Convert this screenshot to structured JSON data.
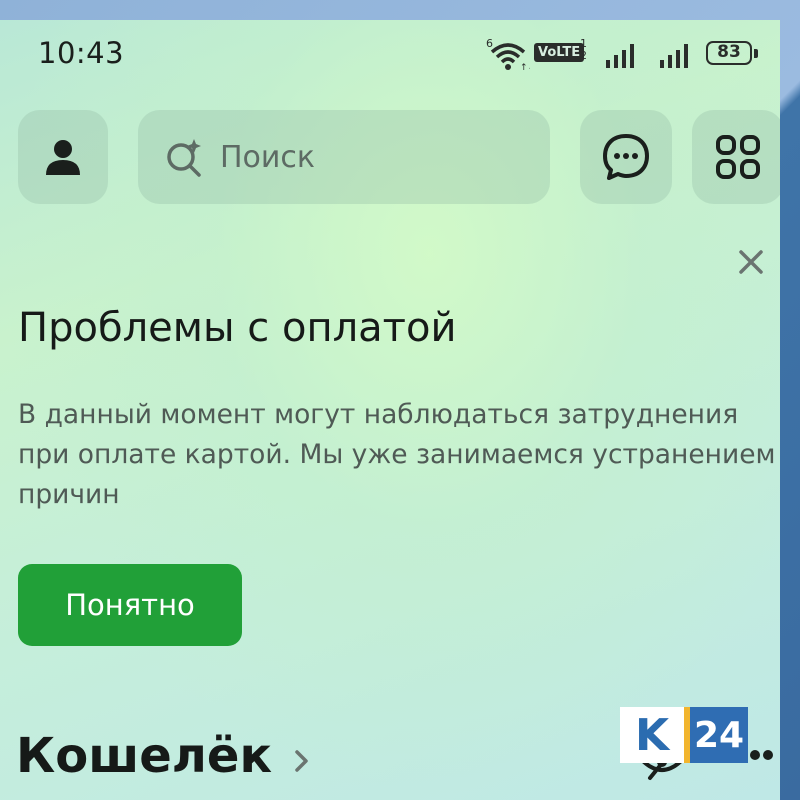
{
  "status_bar": {
    "time": "10:43",
    "network_type": "6",
    "volte": "VoLTE",
    "sim_label": "1 2",
    "battery_level": "83"
  },
  "topbar": {
    "search_placeholder": "Поиск",
    "icons": [
      "profile-icon",
      "ai-search-icon",
      "chat-icon",
      "apps-grid-icon"
    ]
  },
  "banner": {
    "title": "Проблемы с оплатой",
    "text": "В данный момент могут наблюдаться затруднения при оплате картой. Мы уже занимаемся устранением причин",
    "button_label": "Понятно"
  },
  "wallet": {
    "title": "Кошелёк"
  },
  "watermark": {
    "k": "K",
    "num": "24"
  },
  "colors": {
    "accent": "#21a038",
    "frame": "#3d6fa2"
  }
}
